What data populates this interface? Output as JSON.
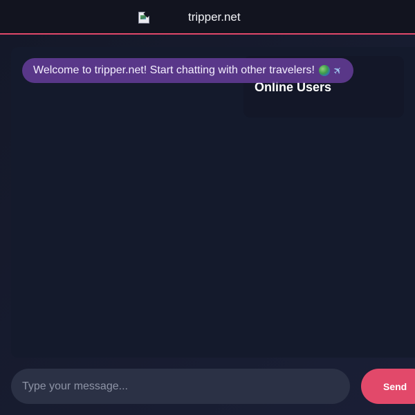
{
  "header": {
    "title": "tripper.net",
    "logo_icon": "broken-image-icon",
    "accent_color": "#e2486a"
  },
  "chat": {
    "welcome_message": "Welcome to tripper.net! Start chatting with other travelers!",
    "welcome_emoji": [
      "globe-icon",
      "airplane-icon"
    ],
    "bubble_color": "#693e9e"
  },
  "online_users": {
    "title": "Online Users",
    "users": []
  },
  "composer": {
    "placeholder": "Type your message...",
    "value": "",
    "send_label": "Send",
    "send_color": "#e2496a"
  }
}
